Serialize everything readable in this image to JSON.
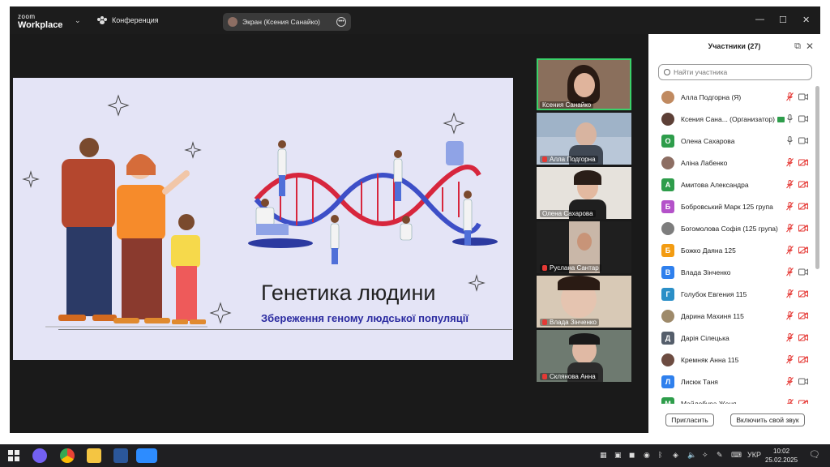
{
  "titlebar": {
    "logo_line1": "zoom",
    "logo_line2": "Workplace",
    "conference_label": "Конференция",
    "screen_share_label": "Экран (Ксения Санайко)"
  },
  "slide": {
    "title": "Генетика людини",
    "subtitle": "Збереження геному людської популяції"
  },
  "videos": [
    {
      "name": "Ксения Санайко",
      "muted": false
    },
    {
      "name": "Алла Подгорна",
      "muted": true
    },
    {
      "name": "Олена Сахарова",
      "muted": false
    },
    {
      "name": "Руслана Сантар",
      "muted": true
    },
    {
      "name": "Влада Зінченко",
      "muted": true
    },
    {
      "name": "Склянова Анна",
      "muted": true
    }
  ],
  "participants_panel": {
    "title": "Участники (27)",
    "search_placeholder": "Найти участника",
    "invite_label": "Пригласить",
    "unmute_label": "Включить свой звук",
    "participants": [
      {
        "name": "Алла Подгорна (Я)",
        "initial": "",
        "color": "#c08a60",
        "mic": "off",
        "cam": "on"
      },
      {
        "name": "Ксения Сана... (Организатор)",
        "initial": "",
        "color": "#5d4037",
        "mic": "on",
        "cam": "on"
      },
      {
        "name": "Олена Сахарова",
        "initial": "О",
        "color": "#2e9d4b",
        "mic": "on",
        "cam": "on"
      },
      {
        "name": "Аліна Лабенко",
        "initial": "",
        "color": "#8d6e63",
        "mic": "off",
        "cam": "off"
      },
      {
        "name": "Амитова Александра",
        "initial": "А",
        "color": "#2e9d4b",
        "mic": "off",
        "cam": "off"
      },
      {
        "name": "Бобровський Марк 125 група",
        "initial": "Б",
        "color": "#b452c9",
        "mic": "off",
        "cam": "off"
      },
      {
        "name": "Богомолова Софія (125 група)",
        "initial": "",
        "color": "#7d7d7d",
        "mic": "off",
        "cam": "off"
      },
      {
        "name": "Божко Даяна 125",
        "initial": "Б",
        "color": "#f39c12",
        "mic": "off",
        "cam": "off"
      },
      {
        "name": "Влада Зінченко",
        "initial": "В",
        "color": "#2f80ed",
        "mic": "off",
        "cam": "on"
      },
      {
        "name": "Голубок Евгения 115",
        "initial": "Г",
        "color": "#2b8fc7",
        "mic": "off",
        "cam": "off"
      },
      {
        "name": "Дарина Махиня 115",
        "initial": "",
        "color": "#9e8a6a",
        "mic": "off",
        "cam": "off"
      },
      {
        "name": "Дарія Сілецька",
        "initial": "Д",
        "color": "#555e6b",
        "mic": "off",
        "cam": "off"
      },
      {
        "name": "Кремняк Анна 115",
        "initial": "",
        "color": "#6d4c41",
        "mic": "off",
        "cam": "off"
      },
      {
        "name": "Лисюк Таня",
        "initial": "Л",
        "color": "#2f80ed",
        "mic": "off",
        "cam": "on"
      },
      {
        "name": "Майдебура Женя",
        "initial": "М",
        "color": "#2e9d4b",
        "mic": "off",
        "cam": "off"
      }
    ]
  },
  "taskbar": {
    "language": "УКР",
    "time": "10:02",
    "date": "25.02.2025"
  },
  "colors": {
    "accent_green": "#3ad16a",
    "mic_off_red": "#e53935",
    "slide_bg": "#e4e4f6"
  }
}
